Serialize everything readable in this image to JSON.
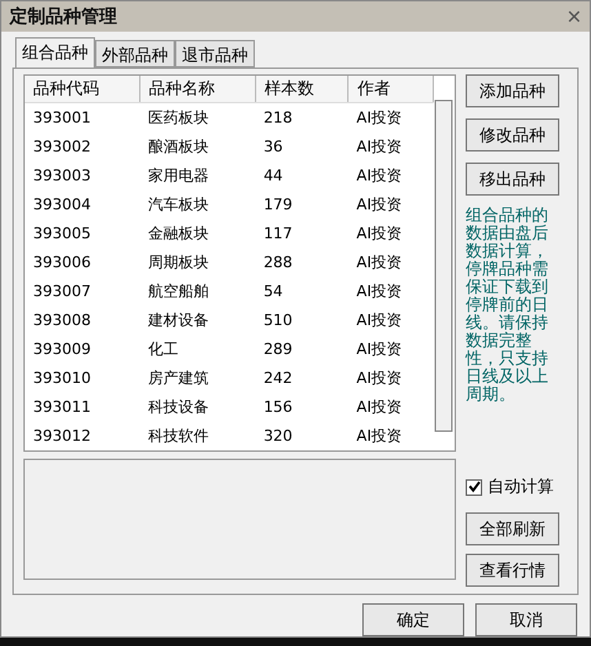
{
  "window": {
    "title": "定制品种管理",
    "close": "×"
  },
  "tabs": [
    {
      "label": "组合品种",
      "selected": true
    },
    {
      "label": "外部品种",
      "selected": false
    },
    {
      "label": "退市品种",
      "selected": false
    }
  ],
  "table": {
    "columns": [
      "品种代码",
      "品种名称",
      "样本数",
      "作者"
    ],
    "rows": [
      [
        "393001",
        "医药板块",
        "218",
        "AI投资"
      ],
      [
        "393002",
        "酿酒板块",
        "36",
        "AI投资"
      ],
      [
        "393003",
        "家用电器",
        "44",
        "AI投资"
      ],
      [
        "393004",
        "汽车板块",
        "179",
        "AI投资"
      ],
      [
        "393005",
        "金融板块",
        "117",
        "AI投资"
      ],
      [
        "393006",
        "周期板块",
        "288",
        "AI投资"
      ],
      [
        "393007",
        "航空船舶",
        "54",
        "AI投资"
      ],
      [
        "393008",
        "建材设备",
        "510",
        "AI投资"
      ],
      [
        "393009",
        "化工",
        "289",
        "AI投资"
      ],
      [
        "393010",
        "房产建筑",
        "242",
        "AI投资"
      ],
      [
        "393011",
        "科技设备",
        "156",
        "AI投资"
      ],
      [
        "393012",
        "科技软件",
        "320",
        "AI投资"
      ]
    ]
  },
  "side_buttons": [
    "添加品种",
    "修改品种",
    "移出品种"
  ],
  "note": "组合品种的数据由盘后数据计算，停牌品种需保证下载到停牌前的日线。请保持数据完整性，只支持日线及以上周期。",
  "auto_calc": {
    "label": "自动计算",
    "checked": true
  },
  "lower_buttons": [
    "全部刷新",
    "查看行情"
  ],
  "footer_buttons": [
    "确定",
    "取消"
  ]
}
